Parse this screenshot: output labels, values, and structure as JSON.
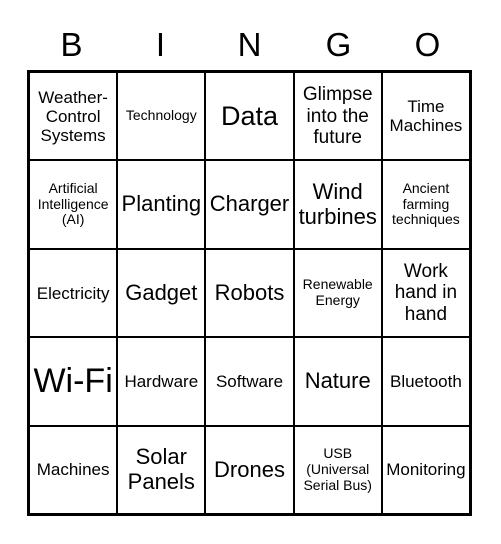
{
  "card": {
    "header_letters": [
      "B",
      "I",
      "N",
      "G",
      "O"
    ],
    "columns": 5,
    "rows": 5,
    "line_color": "#000000",
    "background_color": "#ffffff",
    "text_color": "#000000",
    "cells": [
      [
        {
          "text": "Weather-Control Systems",
          "size": "md"
        },
        {
          "text": "Technology",
          "size": "sm"
        },
        {
          "text": "Data",
          "size": "xxl"
        },
        {
          "text": "Glimpse into the future",
          "size": "lg"
        },
        {
          "text": "Time Machines",
          "size": "md"
        }
      ],
      [
        {
          "text": "Artificial Intelligence (AI)",
          "size": "sm"
        },
        {
          "text": "Planting",
          "size": "xl"
        },
        {
          "text": "Charger",
          "size": "xl"
        },
        {
          "text": "Wind turbines",
          "size": "xl"
        },
        {
          "text": "Ancient farming techniques",
          "size": "sm"
        }
      ],
      [
        {
          "text": "Electricity",
          "size": "md"
        },
        {
          "text": "Gadget",
          "size": "xl"
        },
        {
          "text": "Robots",
          "size": "xl"
        },
        {
          "text": "Renewable Energy",
          "size": "sm"
        },
        {
          "text": "Work hand in hand",
          "size": "lg"
        }
      ],
      [
        {
          "text": "Wi-Fi",
          "size": "huge"
        },
        {
          "text": "Hardware",
          "size": "md"
        },
        {
          "text": "Software",
          "size": "md"
        },
        {
          "text": "Nature",
          "size": "xl"
        },
        {
          "text": "Bluetooth",
          "size": "md"
        }
      ],
      [
        {
          "text": "Machines",
          "size": "md"
        },
        {
          "text": "Solar Panels",
          "size": "xl"
        },
        {
          "text": "Drones",
          "size": "xl"
        },
        {
          "text": "USB (Universal Serial Bus)",
          "size": "sm"
        },
        {
          "text": "Monitoring",
          "size": "md"
        }
      ]
    ]
  }
}
